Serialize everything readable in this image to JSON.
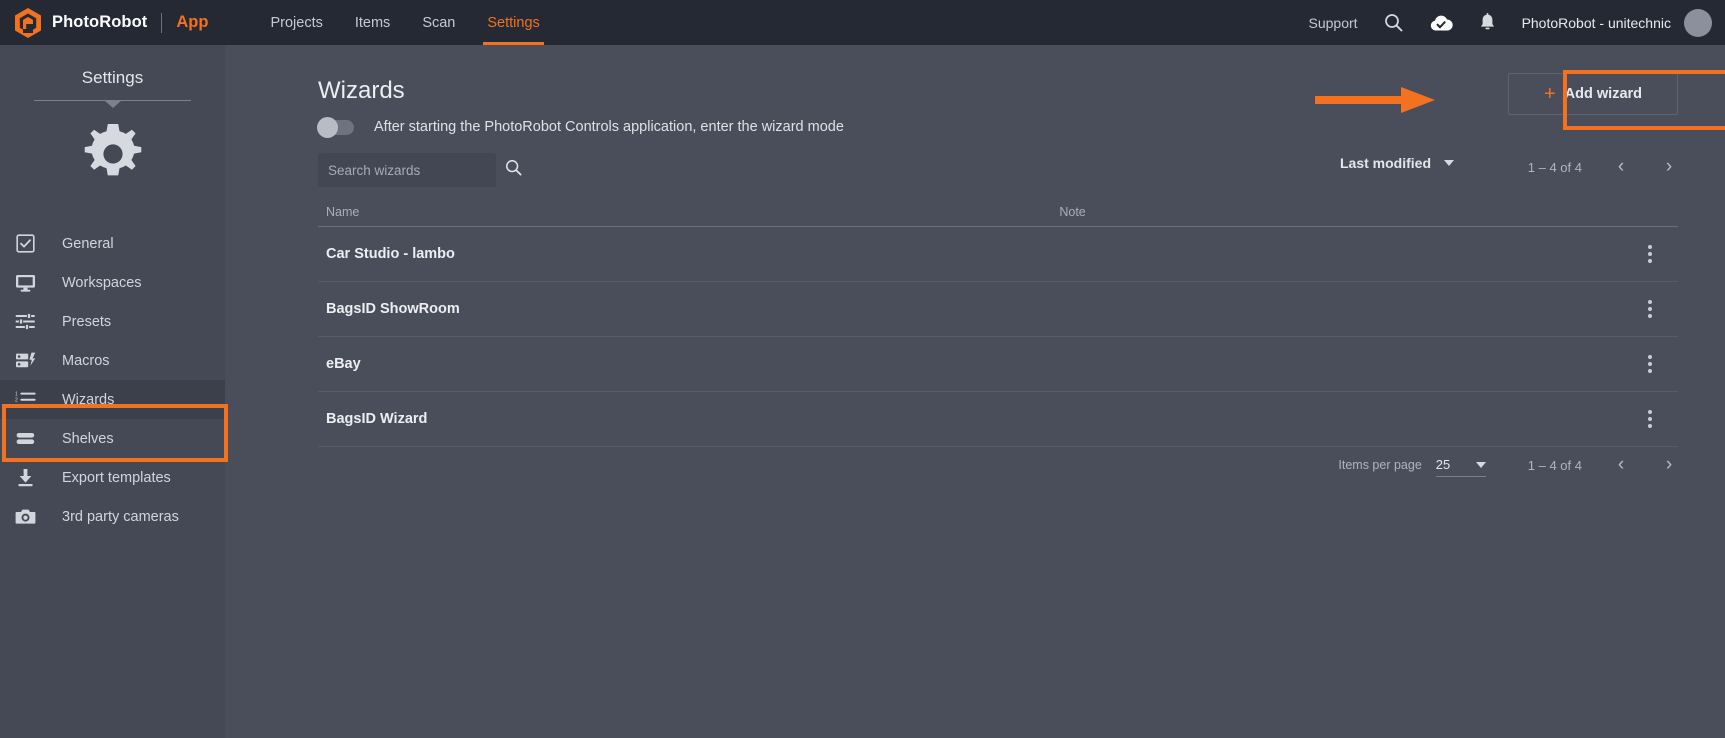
{
  "colors": {
    "accent": "#f4711f",
    "topbar_bg": "#242933",
    "sidebar_bg": "#454956",
    "main_bg": "#4a4e5a"
  },
  "topbar": {
    "logo_icon": "photorobot-hex-logo-icon",
    "brand": "PhotoRobot",
    "app_label": "App",
    "nav": [
      {
        "label": "Projects",
        "active": false
      },
      {
        "label": "Items",
        "active": false
      },
      {
        "label": "Scan",
        "active": false
      },
      {
        "label": "Settings",
        "active": true
      }
    ],
    "support": "Support",
    "search_icon": "search-icon",
    "cloud_icon": "cloud-check-icon",
    "bell_icon": "notification-bell-icon",
    "user": "PhotoRobot - unitechnic",
    "avatar_icon": "avatar"
  },
  "sidebar": {
    "title": "Settings",
    "gear_icon": "gear-icon",
    "items": [
      {
        "label": "General",
        "icon": "checkbox-icon",
        "selected": false
      },
      {
        "label": "Workspaces",
        "icon": "monitor-icon",
        "selected": false
      },
      {
        "label": "Presets",
        "icon": "sliders-icon",
        "selected": false
      },
      {
        "label": "Macros",
        "icon": "macros-icon",
        "selected": false
      },
      {
        "label": "Wizards",
        "icon": "ordered-list-icon",
        "selected": true
      },
      {
        "label": "Shelves",
        "icon": "shelves-icon",
        "selected": false
      },
      {
        "label": "Export templates",
        "icon": "download-icon",
        "selected": false
      },
      {
        "label": "3rd party cameras",
        "icon": "camera-icon",
        "selected": false
      }
    ]
  },
  "main": {
    "title": "Wizards",
    "toggle": {
      "label": "After starting the PhotoRobot Controls application, enter the wizard mode",
      "on": false
    },
    "add_button": {
      "label": "Add wizard",
      "icon": "plus-icon"
    },
    "search": {
      "value": "",
      "placeholder": "Search wizards",
      "icon": "search-icon"
    },
    "sort": {
      "label": "Last modified",
      "icon": "chevron-down-icon"
    },
    "pager_top": {
      "range": "1 – 4 of 4",
      "prev": "‹",
      "next": "›"
    },
    "table": {
      "columns": [
        "Name",
        "Note"
      ],
      "rows": [
        {
          "name": "Car Studio - lambo",
          "note": ""
        },
        {
          "name": "BagsID ShowRoom",
          "note": ""
        },
        {
          "name": "eBay",
          "note": ""
        },
        {
          "name": "BagsID Wizard",
          "note": ""
        }
      ],
      "row_menu_icon": "kebab-menu-icon"
    },
    "footer_pager": {
      "items_per_page_label": "Items per page",
      "items_per_page_value": "25",
      "range": "1 – 4 of 4",
      "prev": "‹",
      "next": "›"
    }
  },
  "annotations": {
    "sidebar_highlight": "wizards-sidebar-highlight",
    "button_highlight": "add-wizard-highlight",
    "arrow": "pointer-arrow"
  }
}
